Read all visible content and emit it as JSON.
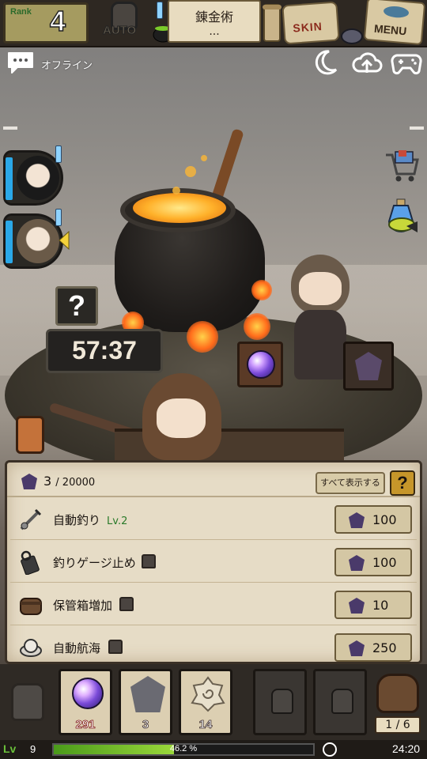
{
  "topbar": {
    "rank_label": "Rank",
    "rank_value": "4",
    "auto_label": "AUTO",
    "title": "錬金術",
    "title_sub": "...",
    "skin_label": "SKIN",
    "menu_label": "MENU"
  },
  "status": {
    "offline_label": "オフライン"
  },
  "scene": {
    "timer": "57:37",
    "question": "?"
  },
  "panel": {
    "currency_count": "3",
    "currency_max": "/ 20000",
    "show_all_label": "すべて表示する",
    "help_label": "?",
    "rows": [
      {
        "name": "自動釣り",
        "level": "Lv.2",
        "cost": "100",
        "locked": false,
        "icon": "auto-fishing-icon"
      },
      {
        "name": "釣りゲージ止め",
        "level": "",
        "cost": "100",
        "locked": true,
        "icon": "gauge-stop-icon"
      },
      {
        "name": "保管箱増加",
        "level": "",
        "cost": "10",
        "locked": true,
        "icon": "storage-box-icon"
      },
      {
        "name": "自動航海",
        "level": "",
        "cost": "250",
        "locked": true,
        "icon": "auto-voyage-icon"
      }
    ]
  },
  "inventory": {
    "slots": [
      {
        "item": "orb",
        "count": "291"
      },
      {
        "item": "shell",
        "count": "3"
      },
      {
        "item": "spiral-shell",
        "count": "14"
      },
      {
        "item": "locked",
        "count": ""
      },
      {
        "item": "locked",
        "count": ""
      }
    ],
    "bag_count": "1 / 6"
  },
  "footer": {
    "level_label": "Lv",
    "level": "9",
    "xp_percent": "46.2 %",
    "xp_fraction": 0.462,
    "time": "24:20"
  }
}
